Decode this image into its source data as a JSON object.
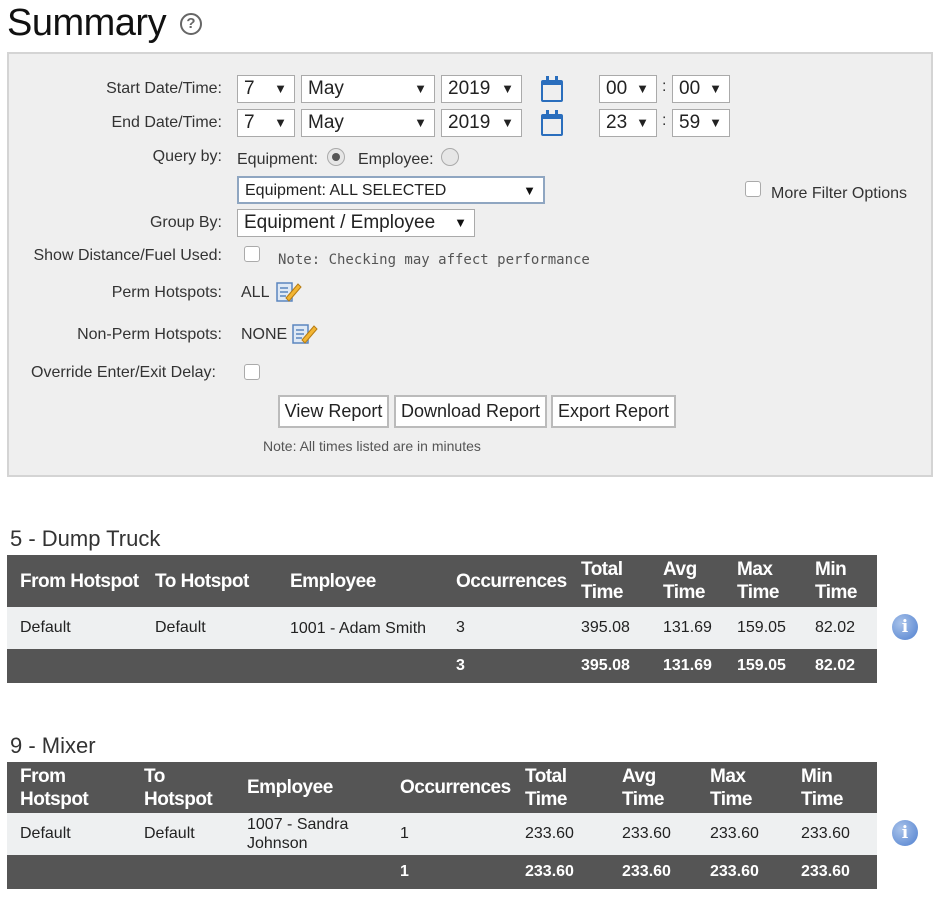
{
  "page": {
    "title": "Summary",
    "help_icon": "?"
  },
  "form": {
    "start_label": "Start Date/Time:",
    "end_label": "End Date/Time:",
    "start": {
      "day": "7",
      "month": "May",
      "year": "2019",
      "hour": "00",
      "minute": "00"
    },
    "end": {
      "day": "7",
      "month": "May",
      "year": "2019",
      "hour": "23",
      "minute": "59"
    },
    "colon": ":",
    "query_by_label": "Query by:",
    "query_equipment": "Equipment:",
    "query_employee": "Employee:",
    "equipment_select": "Equipment: ALL SELECTED",
    "more_filter": "More Filter Options",
    "group_by_label": "Group By:",
    "group_by_value": "Equipment / Employee",
    "show_distance_label": "Show Distance/Fuel Used:",
    "show_distance_note": "Note: Checking may affect performance",
    "perm_label": "Perm Hotspots:",
    "perm_value": "ALL",
    "nonperm_label": "Non-Perm Hotspots:",
    "nonperm_value": "NONE",
    "override_label": "Override Enter/Exit Delay:",
    "view_report": "View Report",
    "download_report": "Download Report",
    "export_report": "Export Report",
    "minutes_note": "Note: All times listed are in minutes"
  },
  "tables": [
    {
      "title": "5 - Dump Truck",
      "headers": [
        "From Hotspot",
        "To Hotspot",
        "Employee",
        "Occurrences",
        "Total Time",
        "Avg Time",
        "Max Time",
        "Min Time"
      ],
      "row": [
        "Default",
        "Default",
        "1001 - Adam Smith",
        "3",
        "395.08",
        "131.69",
        "159.05",
        "82.02"
      ],
      "total": [
        "",
        "",
        "",
        "3",
        "395.08",
        "131.69",
        "159.05",
        "82.02"
      ]
    },
    {
      "title": "9 - Mixer",
      "headers": [
        "From Hotspot",
        "To Hotspot",
        "Employee",
        "Occurrences",
        "Total Time",
        "Avg Time",
        "Max Time",
        "Min Time"
      ],
      "row": [
        "Default",
        "Default",
        "1007 - Sandra Johnson",
        "1",
        "233.60",
        "233.60",
        "233.60",
        "233.60"
      ],
      "total": [
        "",
        "",
        "",
        "1",
        "233.60",
        "233.60",
        "233.60",
        "233.60"
      ]
    }
  ],
  "icons": {
    "info": "i",
    "calendar": "calendar-icon",
    "edit": "edit-icon",
    "dropdown": "▼"
  }
}
